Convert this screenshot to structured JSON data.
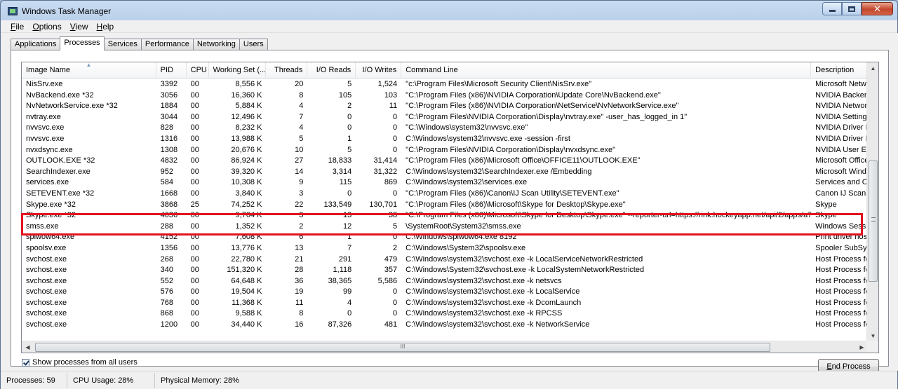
{
  "window": {
    "title": "Windows Task Manager"
  },
  "menu": [
    {
      "label": "File"
    },
    {
      "label": "Options"
    },
    {
      "label": "View"
    },
    {
      "label": "Help"
    }
  ],
  "tabs": [
    {
      "label": "Applications"
    },
    {
      "label": "Processes"
    },
    {
      "label": "Services"
    },
    {
      "label": "Performance"
    },
    {
      "label": "Networking"
    },
    {
      "label": "Users"
    }
  ],
  "active_tab": "Processes",
  "columns": [
    {
      "label": "Image Name"
    },
    {
      "label": "PID"
    },
    {
      "label": "CPU"
    },
    {
      "label": "Working Set (..."
    },
    {
      "label": "Threads"
    },
    {
      "label": "I/O Reads"
    },
    {
      "label": "I/O Writes"
    },
    {
      "label": "Command Line"
    },
    {
      "label": "Description"
    }
  ],
  "processes": [
    [
      "NisSrv.exe",
      "3392",
      "00",
      "8,556 K",
      "20",
      "5",
      "1,524",
      "\"c:\\Program Files\\Microsoft Security Client\\NisSrv.exe\"",
      "Microsoft Network"
    ],
    [
      "NvBackend.exe *32",
      "3056",
      "00",
      "16,360 K",
      "8",
      "105",
      "103",
      "\"C:\\Program Files (x86)\\NVIDIA Corporation\\Update Core\\NvBackend.exe\"",
      "NVIDIA Backend"
    ],
    [
      "NvNetworkService.exe *32",
      "1884",
      "00",
      "5,884 K",
      "4",
      "2",
      "11",
      "\"C:\\Program Files (x86)\\NVIDIA Corporation\\NetService\\NvNetworkService.exe\"",
      "NVIDIA Network Se"
    ],
    [
      "nvtray.exe",
      "3044",
      "00",
      "12,496 K",
      "7",
      "0",
      "0",
      "\"C:\\Program Files\\NVIDIA Corporation\\Display\\nvtray.exe\" -user_has_logged_in 1\"",
      "NVIDIA Settings"
    ],
    [
      "nvvsvc.exe",
      "828",
      "00",
      "8,232 K",
      "4",
      "0",
      "0",
      "\"C:\\Windows\\system32\\nvvsvc.exe\"",
      "NVIDIA Driver Help"
    ],
    [
      "nvvsvc.exe",
      "1316",
      "00",
      "13,988 K",
      "5",
      "1",
      "0",
      "C:\\Windows\\system32\\nvvsvc.exe -session -first",
      "NVIDIA Driver Help"
    ],
    [
      "nvxdsync.exe",
      "1308",
      "00",
      "20,676 K",
      "10",
      "5",
      "0",
      "\"C:\\Program Files\\NVIDIA Corporation\\Display\\nvxdsync.exe\"",
      "NVIDIA User Exper"
    ],
    [
      "OUTLOOK.EXE *32",
      "4832",
      "00",
      "86,924 K",
      "27",
      "18,833",
      "31,414",
      "\"C:\\Program Files (x86)\\Microsoft Office\\OFFICE11\\OUTLOOK.EXE\"",
      "Microsoft Office Ou"
    ],
    [
      "SearchIndexer.exe",
      "952",
      "00",
      "39,320 K",
      "14",
      "3,314",
      "31,322",
      "C:\\Windows\\system32\\SearchIndexer.exe /Embedding",
      "Microsoft Windows"
    ],
    [
      "services.exe",
      "584",
      "00",
      "10,308 K",
      "9",
      "115",
      "869",
      "C:\\Windows\\system32\\services.exe",
      "Services and Contr"
    ],
    [
      "SETEVENT.exe *32",
      "1668",
      "00",
      "3,840 K",
      "3",
      "0",
      "0",
      "\"C:\\Program Files (x86)\\Canon\\IJ Scan Utility\\SETEVENT.exe\"",
      "Canon IJ Scan Utili"
    ],
    [
      "Skype.exe *32",
      "3868",
      "25",
      "74,252 K",
      "22",
      "133,549",
      "130,701",
      "\"C:\\Program Files (x86)\\Microsoft\\Skype for Desktop\\Skype.exe\"",
      "Skype"
    ],
    [
      "Skype.exe *32",
      "4036",
      "00",
      "9,704 K",
      "3",
      "13",
      "38",
      "\"C:\\Program Files (x86)\\Microsoft\\Skype for Desktop\\Skype.exe\" --reporter-url=https://rink.hockeyapp.net/api/2/apps/a74174...",
      "Skype"
    ],
    [
      "smss.exe",
      "288",
      "00",
      "1,352 K",
      "2",
      "12",
      "5",
      "\\SystemRoot\\System32\\smss.exe",
      "Windows Session M"
    ],
    [
      "splwow64.exe",
      "4152",
      "00",
      "7,608 K",
      "6",
      "1",
      "0",
      "C:\\Windows\\splwow64.exe 8192",
      "Print driver host fo"
    ],
    [
      "spoolsv.exe",
      "1356",
      "00",
      "13,776 K",
      "13",
      "7",
      "2",
      "C:\\Windows\\System32\\spoolsv.exe",
      "Spooler SubSystem"
    ],
    [
      "svchost.exe",
      "268",
      "00",
      "22,780 K",
      "21",
      "291",
      "479",
      "C:\\Windows\\system32\\svchost.exe -k LocalServiceNetworkRestricted",
      "Host Process for W"
    ],
    [
      "svchost.exe",
      "340",
      "00",
      "151,320 K",
      "28",
      "1,118",
      "357",
      "C:\\Windows\\System32\\svchost.exe -k LocalSystemNetworkRestricted",
      "Host Process for W"
    ],
    [
      "svchost.exe",
      "552",
      "00",
      "64,648 K",
      "36",
      "38,365",
      "5,586",
      "C:\\Windows\\system32\\svchost.exe -k netsvcs",
      "Host Process for W"
    ],
    [
      "svchost.exe",
      "576",
      "00",
      "19,504 K",
      "19",
      "99",
      "0",
      "C:\\Windows\\system32\\svchost.exe -k LocalService",
      "Host Process for W"
    ],
    [
      "svchost.exe",
      "768",
      "00",
      "11,368 K",
      "11",
      "4",
      "0",
      "C:\\Windows\\system32\\svchost.exe -k DcomLaunch",
      "Host Process for W"
    ],
    [
      "svchost.exe",
      "868",
      "00",
      "9,588 K",
      "8",
      "0",
      "0",
      "C:\\Windows\\system32\\svchost.exe -k RPCSS",
      "Host Process for W"
    ],
    [
      "svchost.exe",
      "1200",
      "00",
      "34,440 K",
      "16",
      "87,326",
      "481",
      "C:\\Windows\\system32\\svchost.exe -k NetworkService",
      "Host Process for W"
    ]
  ],
  "highlighted_processes": [
    "3868",
    "4036"
  ],
  "highlight_color": "#e0141e",
  "hscroll_glyph": "III",
  "show_all_label": "Show processes from all users",
  "show_all_checked": true,
  "end_process_label": "End Process",
  "status": {
    "processes": "Processes: 59",
    "cpu": "CPU Usage: 28%",
    "memory": "Physical Memory: 28%"
  },
  "icons": {
    "app": "task-manager-icon",
    "minimize": "minimize-icon",
    "maximize": "maximize-icon",
    "close": "close-icon",
    "sort": "sort-ascending-icon",
    "scroll_up": "scroll-up-icon",
    "scroll_down": "scroll-down-icon",
    "scroll_left": "scroll-left-icon",
    "scroll_right": "scroll-right-icon",
    "checkbox": "checkbox-checked-icon"
  }
}
